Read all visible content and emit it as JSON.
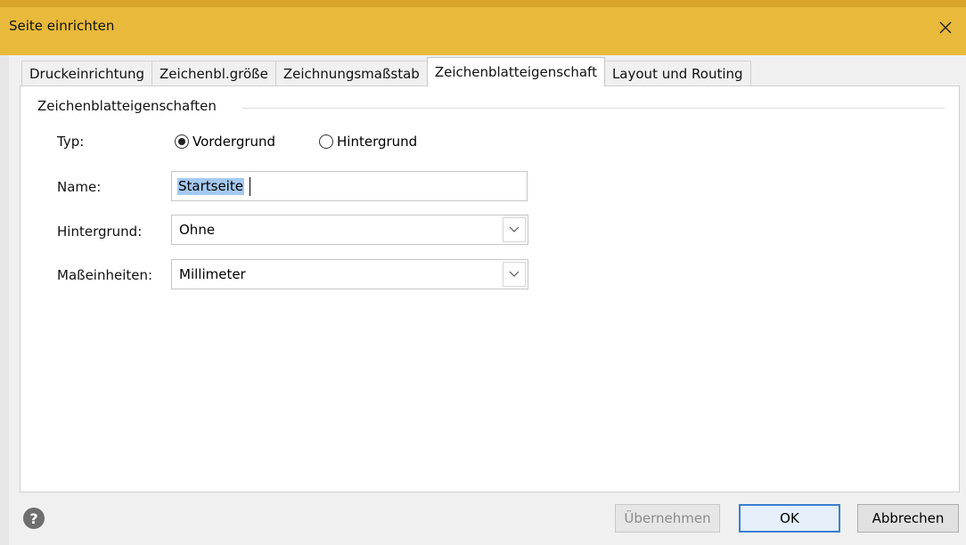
{
  "window": {
    "title": "Seite einrichten",
    "close_label": "✕"
  },
  "tabs": [
    {
      "label": "Druckeinrichtung",
      "active": false
    },
    {
      "label": "Zeichenbl.größe",
      "active": false
    },
    {
      "label": "Zeichnungsmaßstab",
      "active": false
    },
    {
      "label": "Zeichenblatteigenschaft",
      "active": true
    },
    {
      "label": "Layout und Routing",
      "active": false
    }
  ],
  "group": {
    "label": "Zeichenblatteigenschaften"
  },
  "form": {
    "type_label": "Typ:",
    "type_options": [
      {
        "label": "Vordergrund",
        "checked": true
      },
      {
        "label": "Hintergrund",
        "checked": false
      }
    ],
    "name_label": "Name:",
    "name_value": "Startseite",
    "background_label": "Hintergrund:",
    "background_value": "Ohne",
    "units_label": "Maßeinheiten:",
    "units_value": "Millimeter"
  },
  "footer": {
    "help_glyph": "?",
    "apply_label": "Übernehmen",
    "ok_label": "OK",
    "cancel_label": "Abbrechen"
  },
  "colors": {
    "titlebar": "#e8b93a",
    "selection": "#a5c9f0",
    "default_button_border": "#3b7fd1"
  }
}
